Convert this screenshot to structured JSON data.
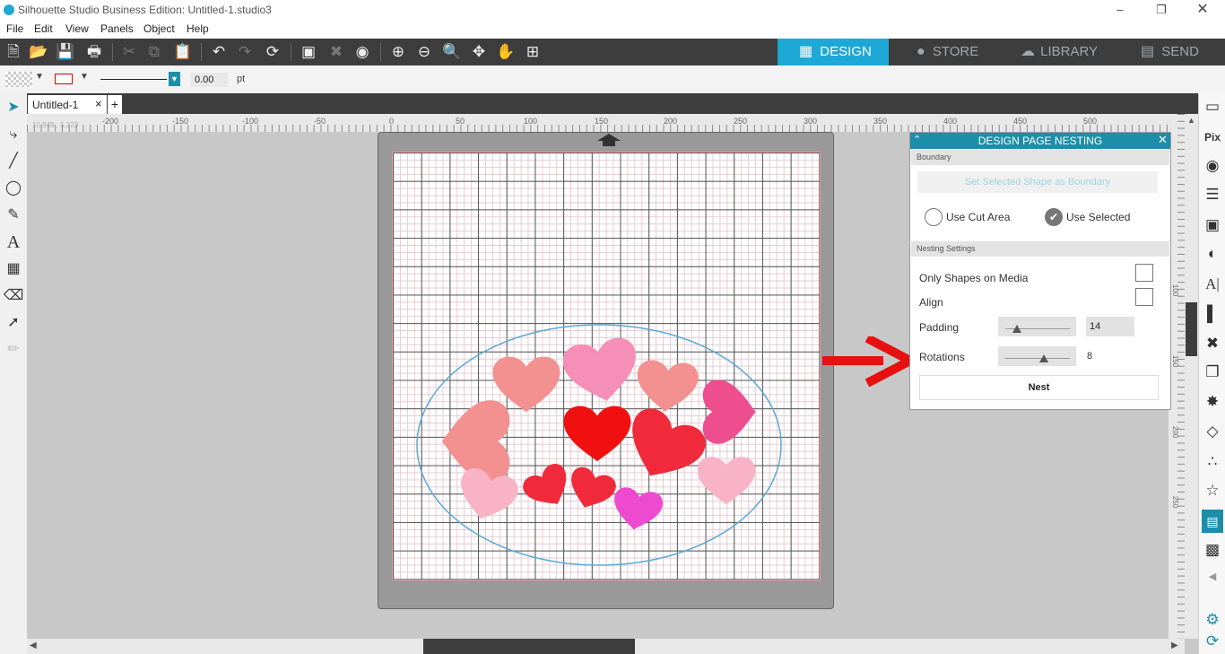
{
  "window": {
    "title": "Silhouette Studio Business Edition: Untitled-1.studio3"
  },
  "menu": [
    "File",
    "Edit",
    "View",
    "Panels",
    "Object",
    "Help"
  ],
  "nav_tabs": [
    {
      "label": "DESIGN",
      "active": true
    },
    {
      "label": "STORE",
      "active": false
    },
    {
      "label": "LIBRARY",
      "active": false
    },
    {
      "label": "SEND",
      "active": false
    }
  ],
  "propbar": {
    "line_width": "0.00",
    "unit": "pt"
  },
  "doc_tab": {
    "name": "Untitled-1",
    "close": "×",
    "add": "+"
  },
  "ruler": {
    "coords": "10.949 , 5.223",
    "h_labels": [
      "-200",
      "-150",
      "-100",
      "-50",
      "0",
      "50",
      "100",
      "150",
      "200",
      "250",
      "300",
      "350",
      "400",
      "450",
      "500"
    ],
    "v_labels": [
      "100",
      "150",
      "200",
      "250"
    ]
  },
  "panel": {
    "title": "DESIGN PAGE NESTING",
    "boundary_section": "Boundary",
    "boundary_button": "Set Selected Shape as Boundary",
    "use_cut_area": "Use Cut Area",
    "use_selected": "Use Selected",
    "nesting_section": "Nesting Settings",
    "only_shapes": "Only Shapes on Media",
    "align": "Align",
    "padding_label": "Padding",
    "padding_value": "14",
    "rotations_label": "Rotations",
    "rotations_value": "8",
    "nest_button": "Nest",
    "padding_level": 0.18,
    "rotations_level": 0.6
  },
  "colors": {
    "accent": "#1ea8d5",
    "panel_header": "#1d8ea8",
    "arrow": "#e81010",
    "ellipse": "#5aa9d6"
  }
}
